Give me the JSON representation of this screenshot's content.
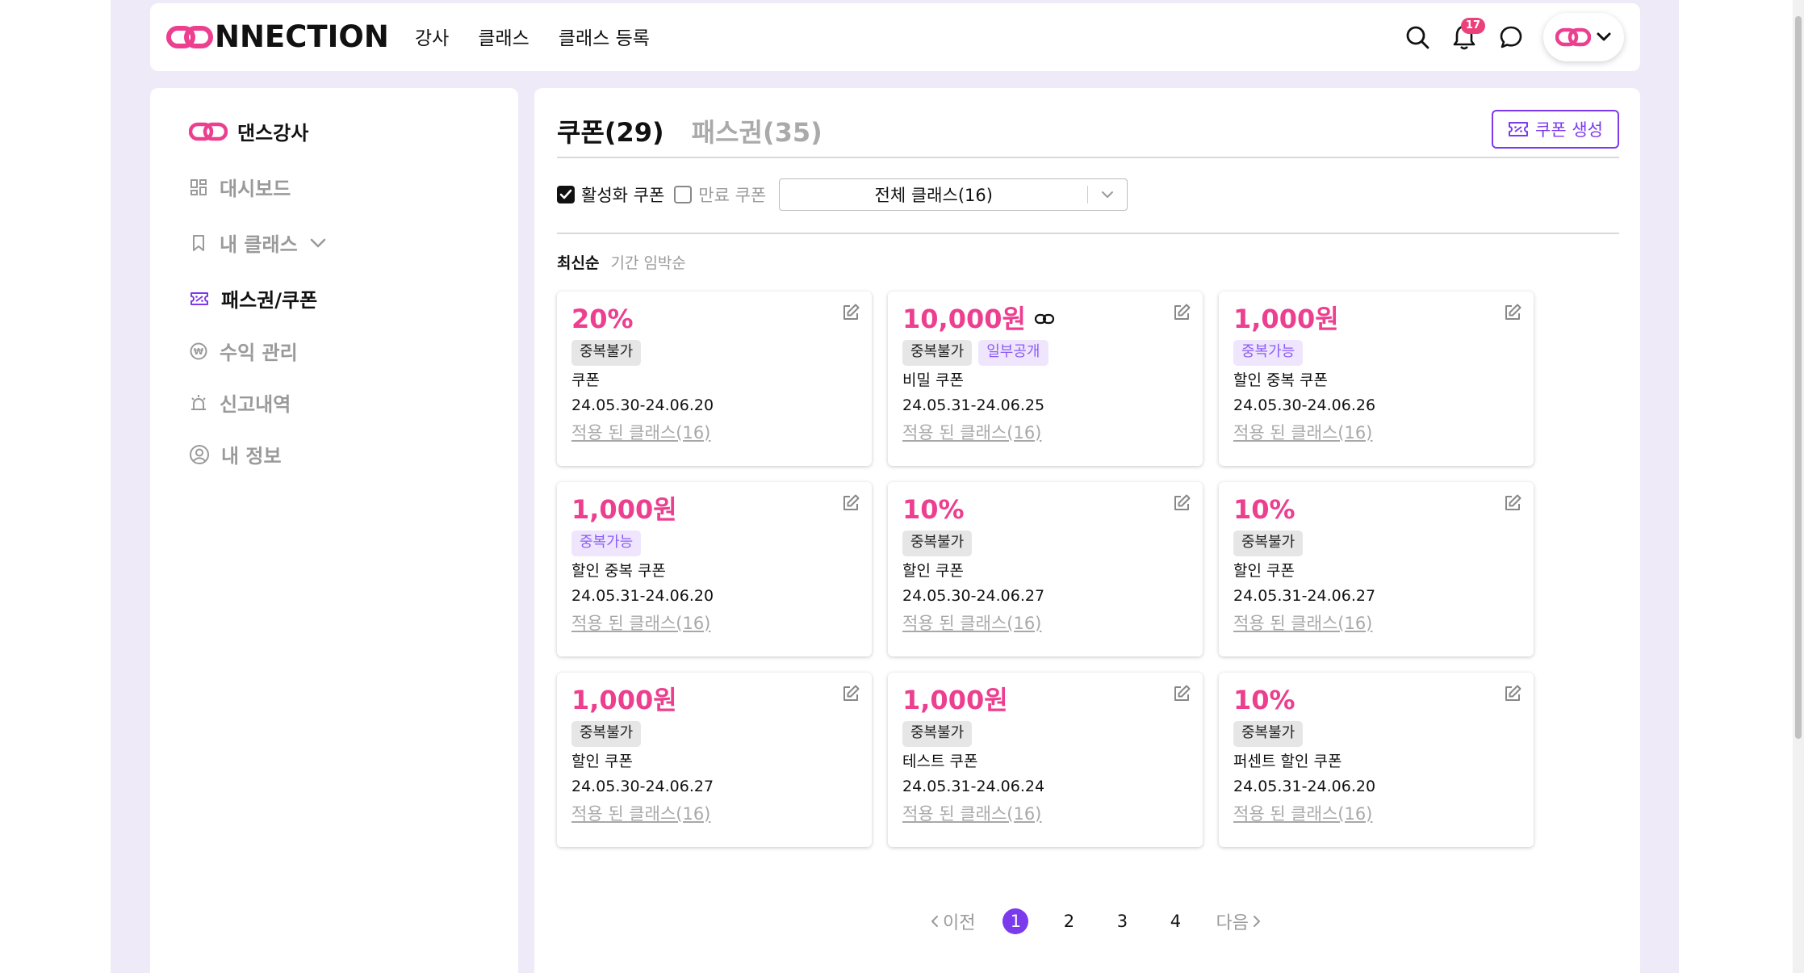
{
  "header": {
    "logo_text": "NNECTION",
    "nav": [
      "강사",
      "클래스",
      "클래스 등록"
    ],
    "notification_count": "17",
    "colors": {
      "brand": "#ec3f8f",
      "accent": "#7c3aed"
    }
  },
  "sidebar": {
    "title": "댄스강사",
    "items": [
      {
        "label": "대시보드",
        "icon": "dashboard-icon"
      },
      {
        "label": "내 클래스",
        "icon": "bookmark-icon"
      },
      {
        "label": "패스권/쿠폰",
        "icon": "ticket-icon",
        "active": true
      },
      {
        "label": "수익 관리",
        "icon": "won-coin-icon"
      },
      {
        "label": "신고내역",
        "icon": "siren-icon"
      },
      {
        "label": "내 정보",
        "icon": "user-circle-icon"
      }
    ]
  },
  "main": {
    "tabs": [
      "쿠폰(29)",
      "패스권(35)"
    ],
    "create_button": "쿠폰 생성",
    "filters": {
      "active_label": "활성화 쿠폰",
      "active_checked": true,
      "expired_label": "만료 쿠폰",
      "expired_checked": false,
      "class_select": "전체 클래스(16)"
    },
    "sort": [
      "최신순",
      "기간 임박순"
    ],
    "cards": [
      {
        "amount": "20%",
        "tags": [
          {
            "text": "중복불가",
            "style": "gray"
          }
        ],
        "name": "쿠폰",
        "date": "24.05.30-24.06.20",
        "link": "적용 된 클래스(16)"
      },
      {
        "amount": "10,000원",
        "has_link_icon": true,
        "tags": [
          {
            "text": "중복불가",
            "style": "gray"
          },
          {
            "text": "일부공개",
            "style": "purple"
          }
        ],
        "name": "비밀 쿠폰",
        "date": "24.05.31-24.06.25",
        "link": "적용 된 클래스(16)"
      },
      {
        "amount": "1,000원",
        "tags": [
          {
            "text": "중복가능",
            "style": "purple"
          }
        ],
        "name": "할인 중복 쿠폰",
        "date": "24.05.30-24.06.26",
        "link": "적용 된 클래스(16)"
      },
      {
        "amount": "1,000원",
        "tags": [
          {
            "text": "중복가능",
            "style": "purple"
          }
        ],
        "name": "할인 중복 쿠폰",
        "date": "24.05.31-24.06.20",
        "link": "적용 된 클래스(16)"
      },
      {
        "amount": "10%",
        "tags": [
          {
            "text": "중복불가",
            "style": "gray"
          }
        ],
        "name": "할인 쿠폰",
        "date": "24.05.30-24.06.27",
        "link": "적용 된 클래스(16)"
      },
      {
        "amount": "10%",
        "tags": [
          {
            "text": "중복불가",
            "style": "gray"
          }
        ],
        "name": "할인 쿠폰",
        "date": "24.05.31-24.06.27",
        "link": "적용 된 클래스(16)"
      },
      {
        "amount": "1,000원",
        "tags": [
          {
            "text": "중복불가",
            "style": "gray"
          }
        ],
        "name": "할인 쿠폰",
        "date": "24.05.30-24.06.27",
        "link": "적용 된 클래스(16)"
      },
      {
        "amount": "1,000원",
        "tags": [
          {
            "text": "중복불가",
            "style": "gray"
          }
        ],
        "name": "테스트 쿠폰",
        "date": "24.05.31-24.06.24",
        "link": "적용 된 클래스(16)"
      },
      {
        "amount": "10%",
        "tags": [
          {
            "text": "중복불가",
            "style": "gray"
          }
        ],
        "name": "퍼센트 할인 쿠폰",
        "date": "24.05.31-24.06.20",
        "link": "적용 된 클래스(16)"
      }
    ],
    "pagination": {
      "prev": "이전",
      "pages": [
        "1",
        "2",
        "3",
        "4"
      ],
      "current": "1",
      "next": "다음"
    }
  }
}
